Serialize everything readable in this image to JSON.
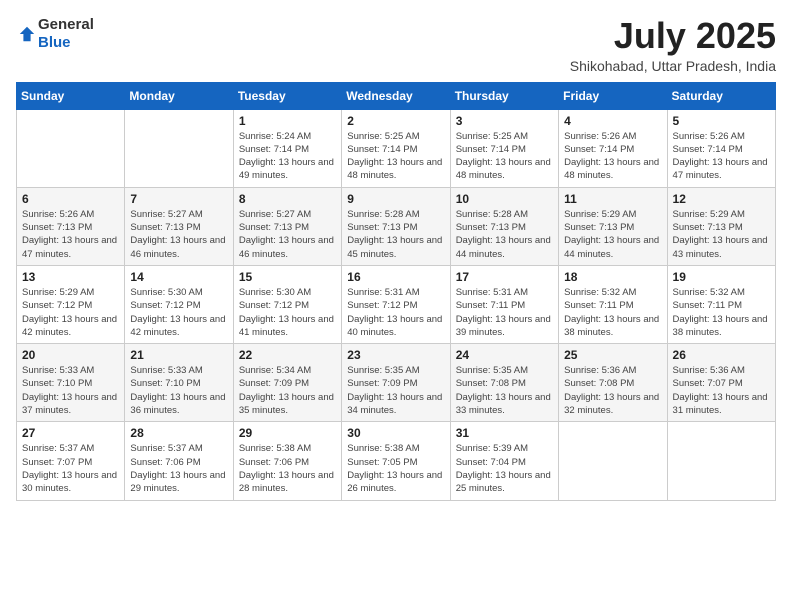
{
  "logo": {
    "general": "General",
    "blue": "Blue"
  },
  "header": {
    "month_year": "July 2025",
    "location": "Shikohabad, Uttar Pradesh, India"
  },
  "weekdays": [
    "Sunday",
    "Monday",
    "Tuesday",
    "Wednesday",
    "Thursday",
    "Friday",
    "Saturday"
  ],
  "weeks": [
    [
      {
        "day": "",
        "sunrise": "",
        "sunset": "",
        "daylight": ""
      },
      {
        "day": "",
        "sunrise": "",
        "sunset": "",
        "daylight": ""
      },
      {
        "day": "1",
        "sunrise": "Sunrise: 5:24 AM",
        "sunset": "Sunset: 7:14 PM",
        "daylight": "Daylight: 13 hours and 49 minutes."
      },
      {
        "day": "2",
        "sunrise": "Sunrise: 5:25 AM",
        "sunset": "Sunset: 7:14 PM",
        "daylight": "Daylight: 13 hours and 48 minutes."
      },
      {
        "day": "3",
        "sunrise": "Sunrise: 5:25 AM",
        "sunset": "Sunset: 7:14 PM",
        "daylight": "Daylight: 13 hours and 48 minutes."
      },
      {
        "day": "4",
        "sunrise": "Sunrise: 5:26 AM",
        "sunset": "Sunset: 7:14 PM",
        "daylight": "Daylight: 13 hours and 48 minutes."
      },
      {
        "day": "5",
        "sunrise": "Sunrise: 5:26 AM",
        "sunset": "Sunset: 7:14 PM",
        "daylight": "Daylight: 13 hours and 47 minutes."
      }
    ],
    [
      {
        "day": "6",
        "sunrise": "Sunrise: 5:26 AM",
        "sunset": "Sunset: 7:13 PM",
        "daylight": "Daylight: 13 hours and 47 minutes."
      },
      {
        "day": "7",
        "sunrise": "Sunrise: 5:27 AM",
        "sunset": "Sunset: 7:13 PM",
        "daylight": "Daylight: 13 hours and 46 minutes."
      },
      {
        "day": "8",
        "sunrise": "Sunrise: 5:27 AM",
        "sunset": "Sunset: 7:13 PM",
        "daylight": "Daylight: 13 hours and 46 minutes."
      },
      {
        "day": "9",
        "sunrise": "Sunrise: 5:28 AM",
        "sunset": "Sunset: 7:13 PM",
        "daylight": "Daylight: 13 hours and 45 minutes."
      },
      {
        "day": "10",
        "sunrise": "Sunrise: 5:28 AM",
        "sunset": "Sunset: 7:13 PM",
        "daylight": "Daylight: 13 hours and 44 minutes."
      },
      {
        "day": "11",
        "sunrise": "Sunrise: 5:29 AM",
        "sunset": "Sunset: 7:13 PM",
        "daylight": "Daylight: 13 hours and 44 minutes."
      },
      {
        "day": "12",
        "sunrise": "Sunrise: 5:29 AM",
        "sunset": "Sunset: 7:13 PM",
        "daylight": "Daylight: 13 hours and 43 minutes."
      }
    ],
    [
      {
        "day": "13",
        "sunrise": "Sunrise: 5:29 AM",
        "sunset": "Sunset: 7:12 PM",
        "daylight": "Daylight: 13 hours and 42 minutes."
      },
      {
        "day": "14",
        "sunrise": "Sunrise: 5:30 AM",
        "sunset": "Sunset: 7:12 PM",
        "daylight": "Daylight: 13 hours and 42 minutes."
      },
      {
        "day": "15",
        "sunrise": "Sunrise: 5:30 AM",
        "sunset": "Sunset: 7:12 PM",
        "daylight": "Daylight: 13 hours and 41 minutes."
      },
      {
        "day": "16",
        "sunrise": "Sunrise: 5:31 AM",
        "sunset": "Sunset: 7:12 PM",
        "daylight": "Daylight: 13 hours and 40 minutes."
      },
      {
        "day": "17",
        "sunrise": "Sunrise: 5:31 AM",
        "sunset": "Sunset: 7:11 PM",
        "daylight": "Daylight: 13 hours and 39 minutes."
      },
      {
        "day": "18",
        "sunrise": "Sunrise: 5:32 AM",
        "sunset": "Sunset: 7:11 PM",
        "daylight": "Daylight: 13 hours and 38 minutes."
      },
      {
        "day": "19",
        "sunrise": "Sunrise: 5:32 AM",
        "sunset": "Sunset: 7:11 PM",
        "daylight": "Daylight: 13 hours and 38 minutes."
      }
    ],
    [
      {
        "day": "20",
        "sunrise": "Sunrise: 5:33 AM",
        "sunset": "Sunset: 7:10 PM",
        "daylight": "Daylight: 13 hours and 37 minutes."
      },
      {
        "day": "21",
        "sunrise": "Sunrise: 5:33 AM",
        "sunset": "Sunset: 7:10 PM",
        "daylight": "Daylight: 13 hours and 36 minutes."
      },
      {
        "day": "22",
        "sunrise": "Sunrise: 5:34 AM",
        "sunset": "Sunset: 7:09 PM",
        "daylight": "Daylight: 13 hours and 35 minutes."
      },
      {
        "day": "23",
        "sunrise": "Sunrise: 5:35 AM",
        "sunset": "Sunset: 7:09 PM",
        "daylight": "Daylight: 13 hours and 34 minutes."
      },
      {
        "day": "24",
        "sunrise": "Sunrise: 5:35 AM",
        "sunset": "Sunset: 7:08 PM",
        "daylight": "Daylight: 13 hours and 33 minutes."
      },
      {
        "day": "25",
        "sunrise": "Sunrise: 5:36 AM",
        "sunset": "Sunset: 7:08 PM",
        "daylight": "Daylight: 13 hours and 32 minutes."
      },
      {
        "day": "26",
        "sunrise": "Sunrise: 5:36 AM",
        "sunset": "Sunset: 7:07 PM",
        "daylight": "Daylight: 13 hours and 31 minutes."
      }
    ],
    [
      {
        "day": "27",
        "sunrise": "Sunrise: 5:37 AM",
        "sunset": "Sunset: 7:07 PM",
        "daylight": "Daylight: 13 hours and 30 minutes."
      },
      {
        "day": "28",
        "sunrise": "Sunrise: 5:37 AM",
        "sunset": "Sunset: 7:06 PM",
        "daylight": "Daylight: 13 hours and 29 minutes."
      },
      {
        "day": "29",
        "sunrise": "Sunrise: 5:38 AM",
        "sunset": "Sunset: 7:06 PM",
        "daylight": "Daylight: 13 hours and 28 minutes."
      },
      {
        "day": "30",
        "sunrise": "Sunrise: 5:38 AM",
        "sunset": "Sunset: 7:05 PM",
        "daylight": "Daylight: 13 hours and 26 minutes."
      },
      {
        "day": "31",
        "sunrise": "Sunrise: 5:39 AM",
        "sunset": "Sunset: 7:04 PM",
        "daylight": "Daylight: 13 hours and 25 minutes."
      },
      {
        "day": "",
        "sunrise": "",
        "sunset": "",
        "daylight": ""
      },
      {
        "day": "",
        "sunrise": "",
        "sunset": "",
        "daylight": ""
      }
    ]
  ]
}
